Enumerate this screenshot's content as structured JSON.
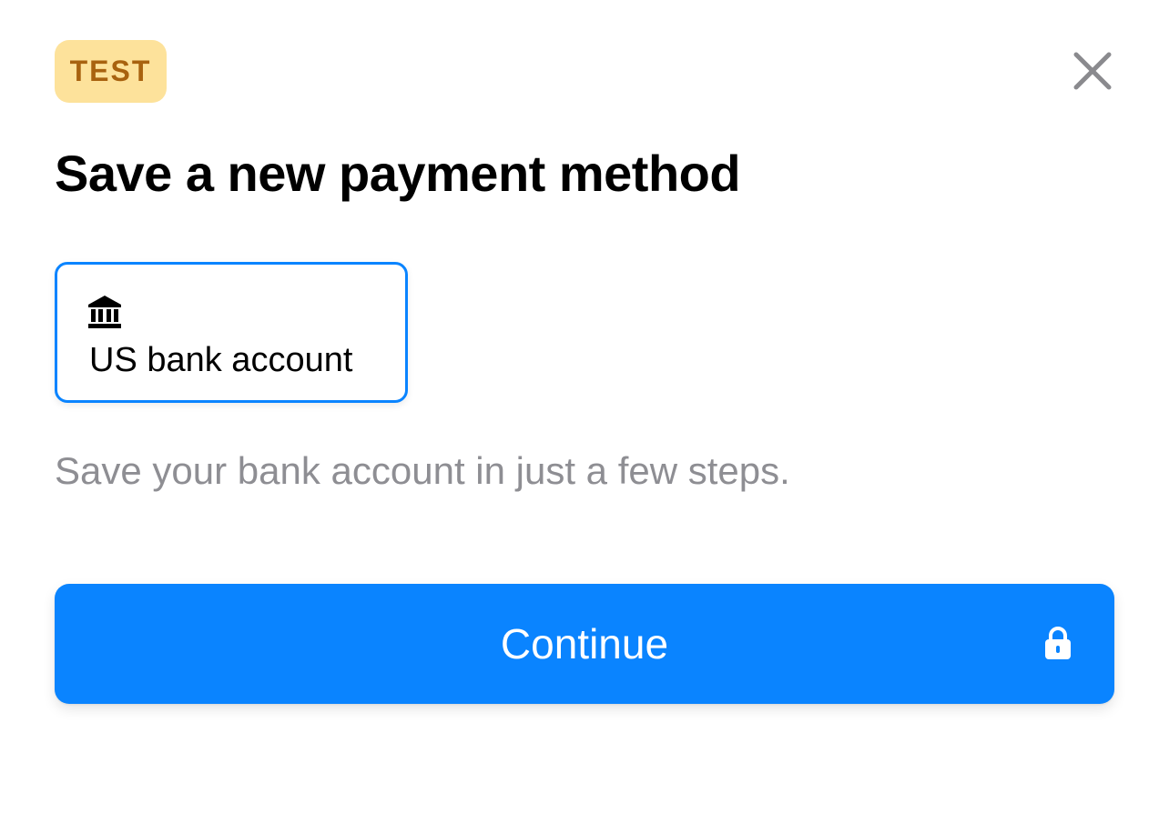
{
  "badge": {
    "label": "TEST"
  },
  "header": {
    "close_icon": "close-icon"
  },
  "title": "Save a new payment method",
  "payment_methods": [
    {
      "label": "US bank account",
      "icon": "bank-icon",
      "selected": true
    }
  ],
  "helper_text": "Save your bank account in just a few steps.",
  "primary_action": {
    "label": "Continue",
    "icon": "lock-icon"
  },
  "colors": {
    "accent": "#0a84ff",
    "badge_bg": "#fde29b",
    "badge_text": "#a8620f",
    "muted_text": "#8e8e93",
    "close_icon": "#8a8a8e"
  }
}
